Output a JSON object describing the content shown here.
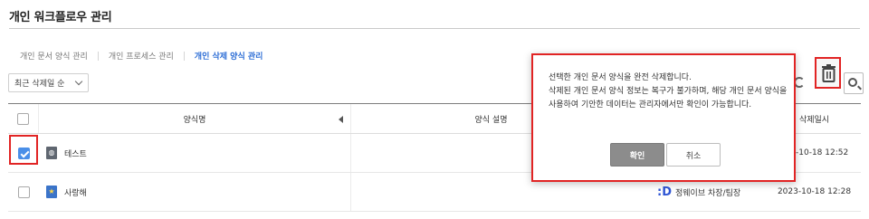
{
  "header": {
    "title": "개인 워크플로우 관리"
  },
  "tabs": [
    {
      "label": "개인 문서 양식 관리",
      "active": false
    },
    {
      "label": "개인 프로세스 관리",
      "active": false
    },
    {
      "label": "개인 삭제 양식 관리",
      "active": true
    }
  ],
  "sort": {
    "selected": "최근 삭제일 순"
  },
  "table": {
    "columns": [
      "양식명",
      "양식 설명",
      "삭제일시"
    ],
    "rows": [
      {
        "checked": true,
        "icon": "globe-doc-icon",
        "name": "테스트",
        "description": "",
        "owner": "",
        "deleted_at": "023-10-18 12:52"
      },
      {
        "checked": false,
        "icon": "star-doc-icon",
        "name": "사랑해",
        "description": "",
        "owner_logo": ":D",
        "owner": "정웨이브 차장/팀장",
        "deleted_at": "2023-10-18 12:28"
      }
    ]
  },
  "toolbar": {
    "delete_icon": "trash-icon",
    "refresh_icon": "refresh-icon",
    "search_icon": "search-icon"
  },
  "modal": {
    "lines": [
      "선택한 개인 문서 양식을 완전 삭제합니다.",
      "삭제된 개인 문서 양식 정보는 복구가 불가하며, 해당 개인 문서 양식을 사용하여 기안한 데이터는 관리자에서만 확인이 가능합니다."
    ],
    "confirm_label": "확인",
    "cancel_label": "취소"
  },
  "colors": {
    "accent": "#2f6fd6",
    "highlight": "#e12424",
    "checkbox": "#4a8fe8"
  }
}
